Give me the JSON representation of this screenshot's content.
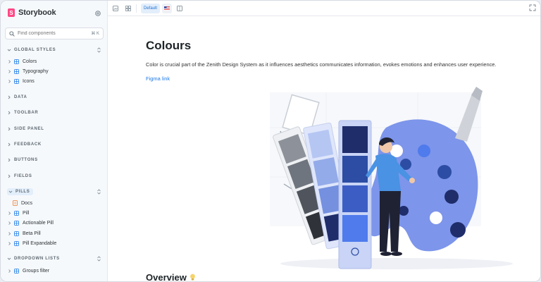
{
  "brand": {
    "name": "Storybook",
    "logo_letter": "S"
  },
  "search": {
    "placeholder": "Find components",
    "shortcut": "⌘ K"
  },
  "sidebar": {
    "global_styles": {
      "label": "GLOBAL STYLES",
      "items": [
        "Colors",
        "Typography",
        "Icons"
      ]
    },
    "groups": [
      "DATA",
      "TOOLBAR",
      "SIDE PANEL",
      "FEEDBACK",
      "BUTTONS",
      "FIELDS"
    ],
    "pills": {
      "label": "PILLS",
      "doc": "Docs",
      "items": [
        "Pill",
        "Actionable Pill",
        "Beta Pill",
        "Pill Expandable"
      ]
    },
    "dropdown_lists": {
      "label": "DROPDOWN LISTS",
      "items": [
        "Groups filter"
      ]
    }
  },
  "toolbar": {
    "theme_label": "Default"
  },
  "page": {
    "title": "Colours",
    "description": "Color is crucial part of the Zenith Design System as it influences aesthetics communicates information, evokes emotions and enhances user experience.",
    "link": "Figma link",
    "section": "Overview"
  },
  "colors": {
    "accent": "#1e7ae8",
    "brand": "#ff4785",
    "swatch_dark": "#1f2d6b",
    "swatch_mid": "#2c4da3",
    "swatch_light": "#4f7bec",
    "palette": "#7d95ea"
  }
}
